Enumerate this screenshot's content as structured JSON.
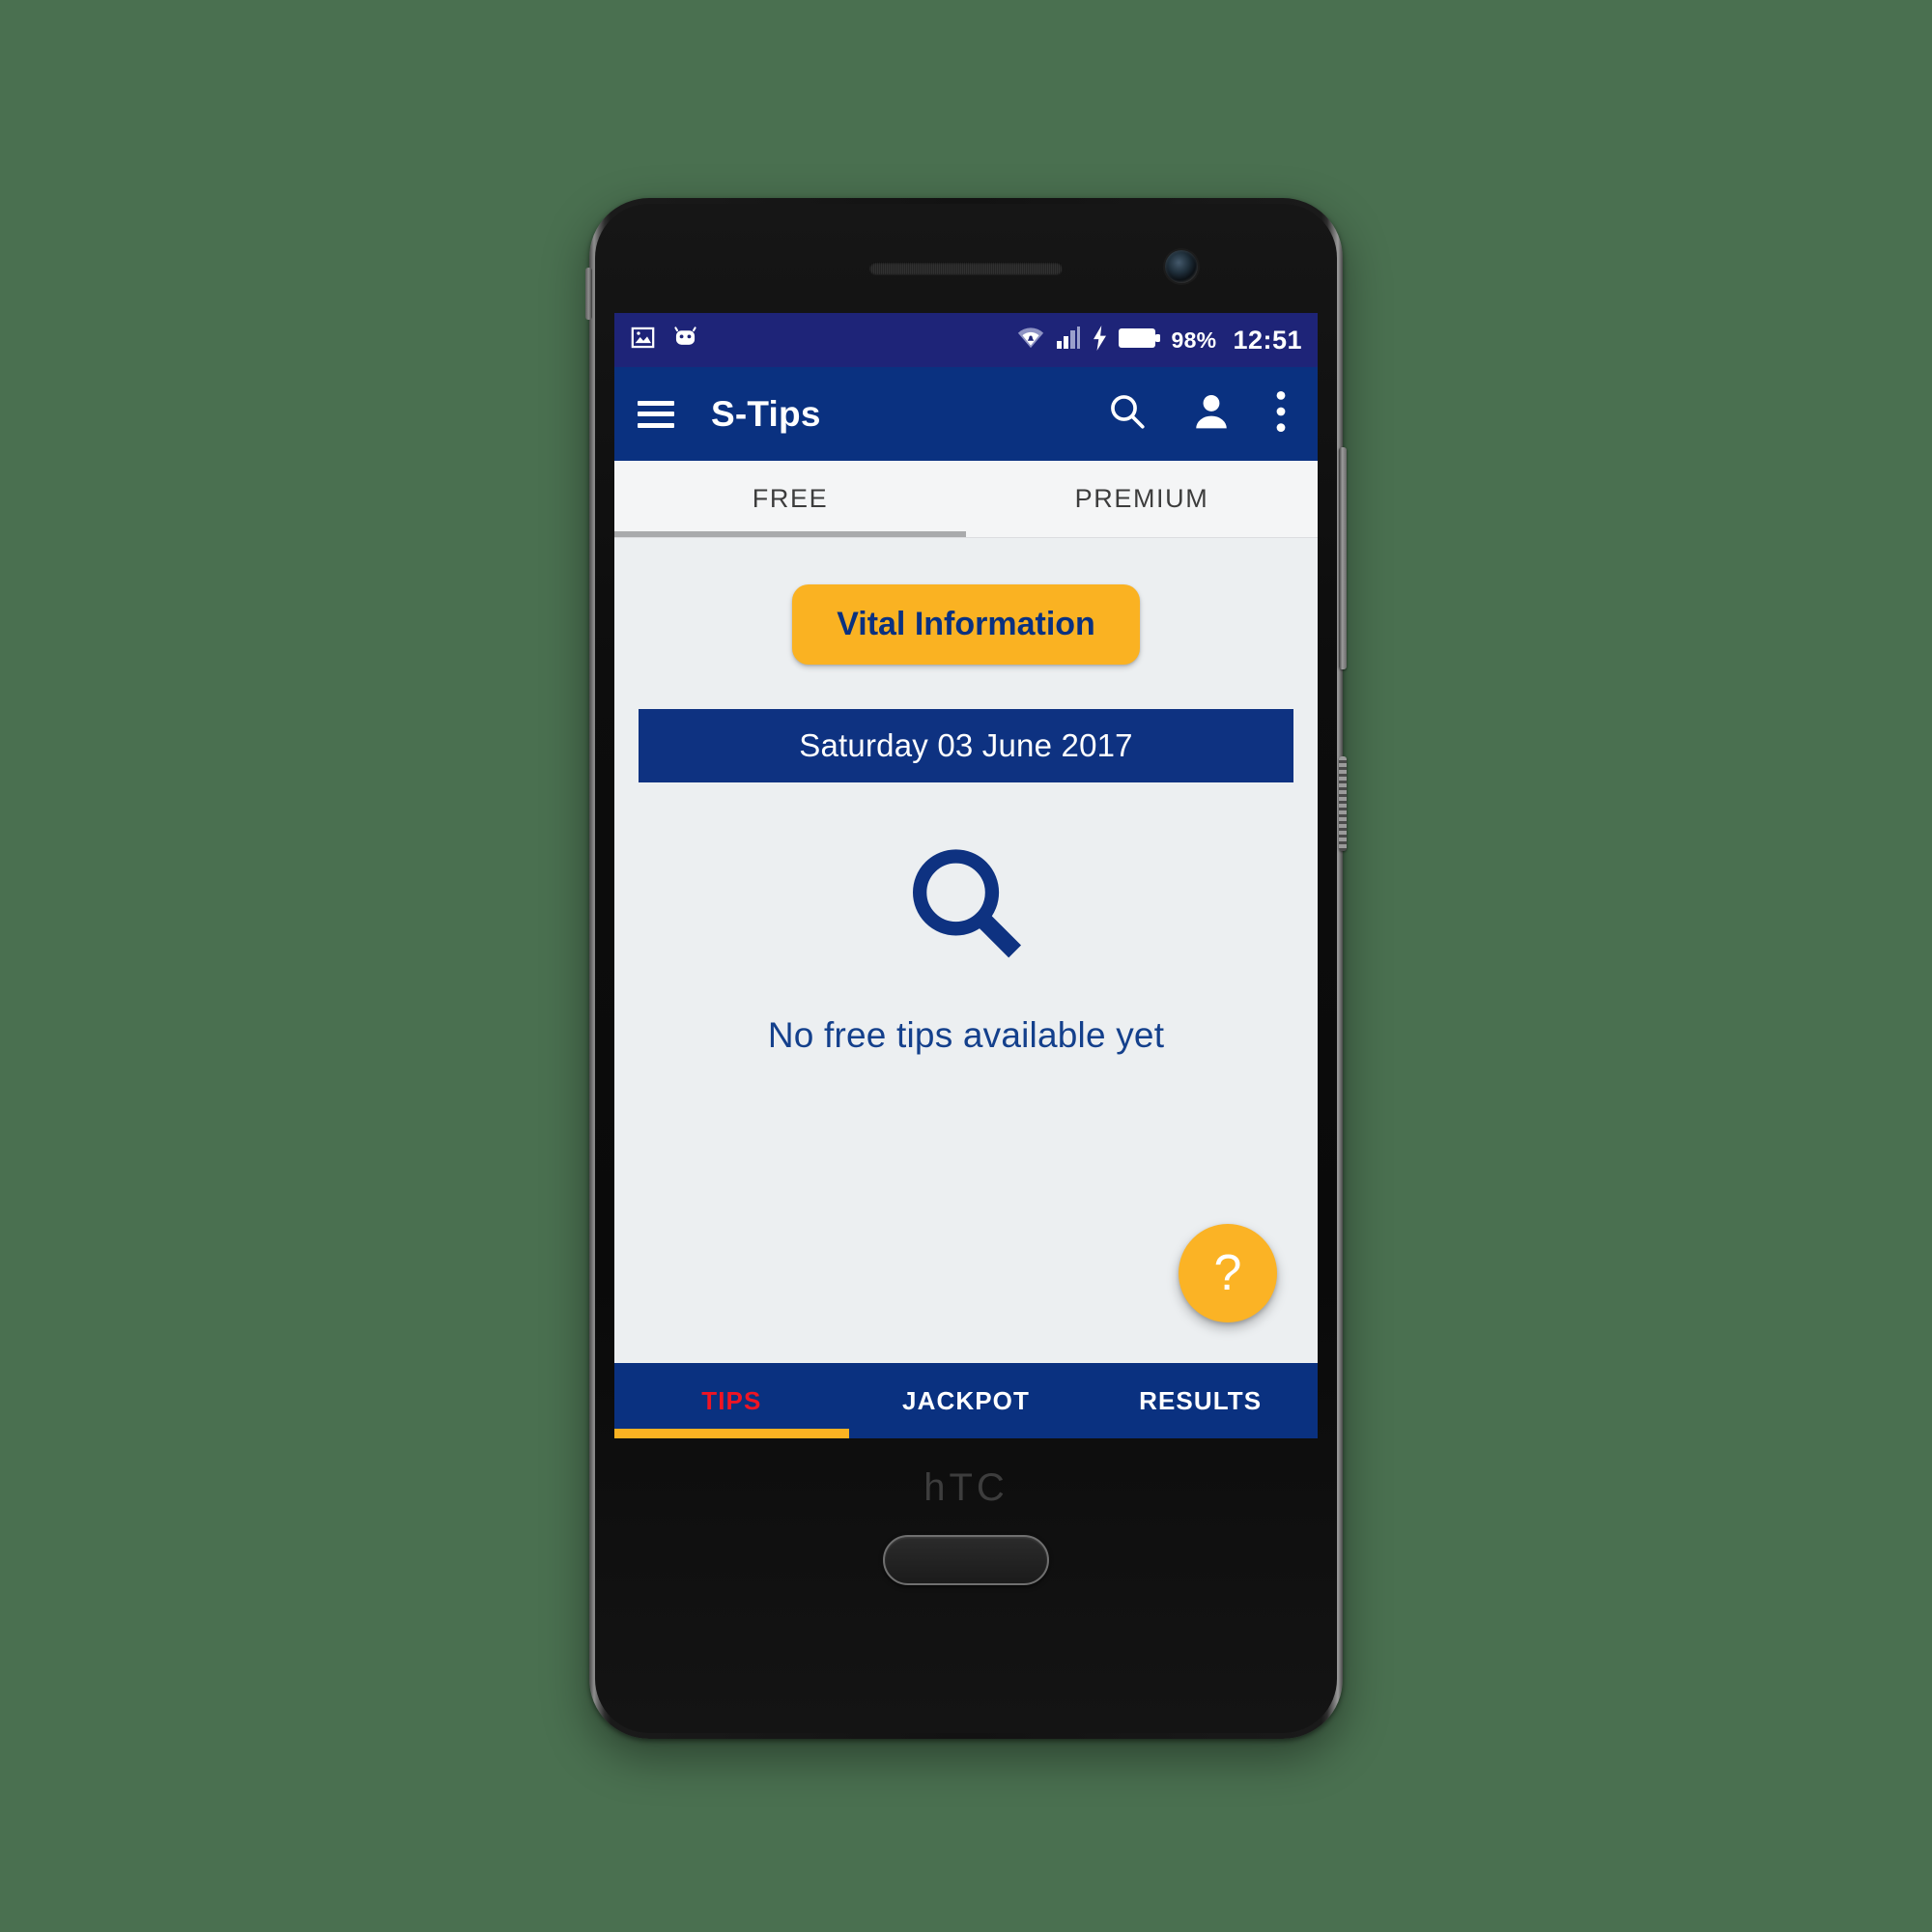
{
  "device": {
    "brand_logo": "hTC",
    "home_button_name": "home-button"
  },
  "statusbar": {
    "icons_left": [
      "image-icon",
      "android-robot-icon"
    ],
    "icons_right": [
      "wifi-icon",
      "signal-bars-icon",
      "charging-bolt-icon",
      "battery-icon"
    ],
    "battery_percent": "98%",
    "clock": "12:51",
    "background_color": "#1e2478"
  },
  "appbar": {
    "menu_icon": "hamburger-menu-icon",
    "title": "S-Tips",
    "search_icon": "search-icon",
    "account_icon": "person-icon",
    "overflow_icon": "more-vertical-icon",
    "background_color": "#0a3180"
  },
  "tabs": {
    "items": [
      {
        "label": "FREE",
        "active": true
      },
      {
        "label": "PREMIUM",
        "active": false
      }
    ],
    "indicator_color": "#a9aaac"
  },
  "main": {
    "vital_button": {
      "label": "Vital Information",
      "background_color": "#fab222",
      "text_color": "#0a3180"
    },
    "date_bar": {
      "label": "Saturday 03 June 2017",
      "background_color": "#0e3281",
      "text_color": "#ffffff"
    },
    "empty_state": {
      "icon": "magnifier-icon",
      "icon_color": "#0e3281",
      "message": "No free tips available yet"
    },
    "fab": {
      "label": "?",
      "icon": "question-mark-icon",
      "background_color": "#fbb325"
    },
    "background_color": "#eceff1"
  },
  "bottomnav": {
    "items": [
      {
        "label": "TIPS",
        "active": true
      },
      {
        "label": "JACKPOT",
        "active": false
      },
      {
        "label": "RESULTS",
        "active": false
      }
    ],
    "active_color": "#f01423",
    "inactive_color": "#ffffff",
    "indicator_color": "#fab222",
    "background_color": "#0a3180"
  },
  "page": {
    "background_color": "#4a7050"
  }
}
